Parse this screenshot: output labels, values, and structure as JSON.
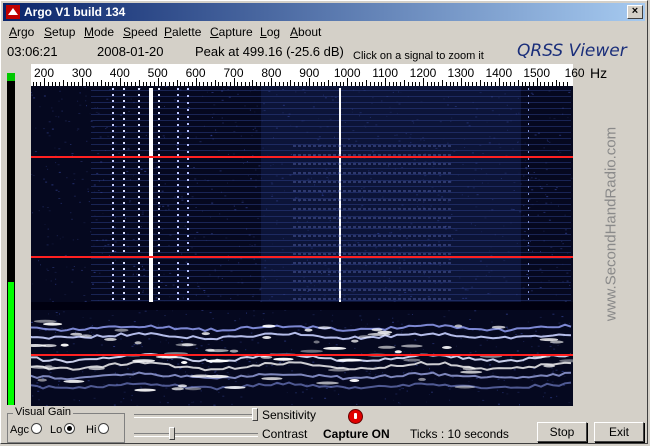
{
  "window": {
    "title": "Argo V1 build 134",
    "close_glyph": "×"
  },
  "menu": [
    "Argo",
    "Setup",
    "Mode",
    "Speed",
    "Palette",
    "Capture",
    "Log",
    "About"
  ],
  "status": {
    "time": "03:06:21",
    "date": "2008-01-20",
    "peak": "Peak at 499.16 (-25.6 dB)",
    "hint": "Click on a signal to zoom it"
  },
  "brand": "QRSS Viewer",
  "scale": {
    "labels": [
      "200",
      "300",
      "400",
      "500",
      "600",
      "700",
      "800",
      "900",
      "1000",
      "1100",
      "1200",
      "1300",
      "1400",
      "1500",
      "160"
    ],
    "unit": "Hz"
  },
  "watermark": "www.SecondHandRadio.com",
  "controls": {
    "visual_gain": "Visual Gain",
    "agc": "Agc",
    "lo": "Lo",
    "hi": "Hi",
    "selected_gain": "Lo",
    "sensitivity": "Sensitivity",
    "contrast": "Contrast",
    "sensitivity_level": 1.0,
    "contrast_level": 0.3,
    "capture_status": "Capture ON",
    "ticks": "Ticks   : 10 seconds",
    "stop": "Stop",
    "exit": "Exit"
  },
  "colors": {
    "title_start": "#0a246a",
    "title_end": "#a6caf0",
    "separator": "#ff2020",
    "spectro_bg": "#05081f",
    "trace": "#ffffff"
  }
}
